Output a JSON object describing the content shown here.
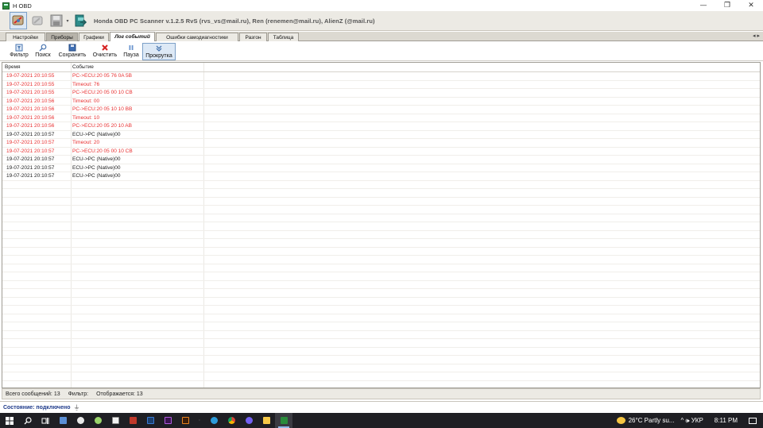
{
  "window": {
    "title": "H OBD",
    "controls": [
      "—",
      "❐",
      "✕"
    ]
  },
  "toolbar": {
    "caption": "Honda OBD PC Scanner v.1.2.5  RvS (rvs_vs@mail.ru), Ren (renemen@mail.ru), AlienZ (@mail.ru)",
    "buttons": [
      "connect-icon",
      "disconnect-icon",
      "save-icon",
      "export-icon"
    ]
  },
  "tabs": [
    {
      "label": "Настройки"
    },
    {
      "label": "Приборы"
    },
    {
      "label": "Графики"
    },
    {
      "label": "Лог событий"
    },
    {
      "label": "Ошибки самодиагностики"
    },
    {
      "label": "Разгон"
    },
    {
      "label": "Таблица"
    }
  ],
  "tab_scroll": "◂ ▸",
  "log_toolbar": {
    "filter": "Фильтр",
    "search": "Поиск",
    "save": "Сохранить",
    "clear": "Очистить",
    "pause": "Пауза",
    "scroll": "Прокрутка"
  },
  "grid": {
    "columns": [
      "Время",
      "Событие"
    ],
    "rows": [
      {
        "time": "19-07-2021 20:10:55",
        "event": "PC->ECU:20 05 76 0A 5B",
        "kind": "sent"
      },
      {
        "time": "19-07-2021 20:10:55",
        "event": "Timeout: 76",
        "kind": "sent"
      },
      {
        "time": "19-07-2021 20:10:55",
        "event": "PC->ECU:20 05 00 10 CB",
        "kind": "sent"
      },
      {
        "time": "19-07-2021 20:10:56",
        "event": "Timeout: 00",
        "kind": "sent"
      },
      {
        "time": "19-07-2021 20:10:56",
        "event": "PC->ECU:20 05 10 10 BB",
        "kind": "sent"
      },
      {
        "time": "19-07-2021 20:10:56",
        "event": "Timeout: 10",
        "kind": "sent"
      },
      {
        "time": "19-07-2021 20:10:56",
        "event": "PC->ECU:20 05 20 10 AB",
        "kind": "sent"
      },
      {
        "time": "19-07-2021 20:10:57",
        "event": "ECU->PC (Native)00",
        "kind": "recv"
      },
      {
        "time": "19-07-2021 20:10:57",
        "event": "Timeout: 20",
        "kind": "sent"
      },
      {
        "time": "19-07-2021 20:10:57",
        "event": "PC->ECU:20 05 00 10 CB",
        "kind": "sent"
      },
      {
        "time": "19-07-2021 20:10:57",
        "event": "ECU->PC (Native)00",
        "kind": "recv"
      },
      {
        "time": "19-07-2021 20:10:57",
        "event": "ECU->PC (Native)00",
        "kind": "recv"
      },
      {
        "time": "19-07-2021 20:10:57",
        "event": "ECU->PC (Native)00",
        "kind": "recv"
      }
    ]
  },
  "grid_status": {
    "total": "Всего сообщений: 13",
    "filter": "Фильтр:",
    "shown": "Отображается: 13"
  },
  "app_status": {
    "state": "Состояние: подключено"
  },
  "taskbar": {
    "weather": "26°C  Partly su...",
    "tray_icons": "^  🕪  УКР",
    "time": "8:11 PM"
  },
  "colors": {
    "sent": "#e83030",
    "recv": "#222222",
    "status_text": "#1e3a8a",
    "taskbar": "#1f1f24"
  }
}
